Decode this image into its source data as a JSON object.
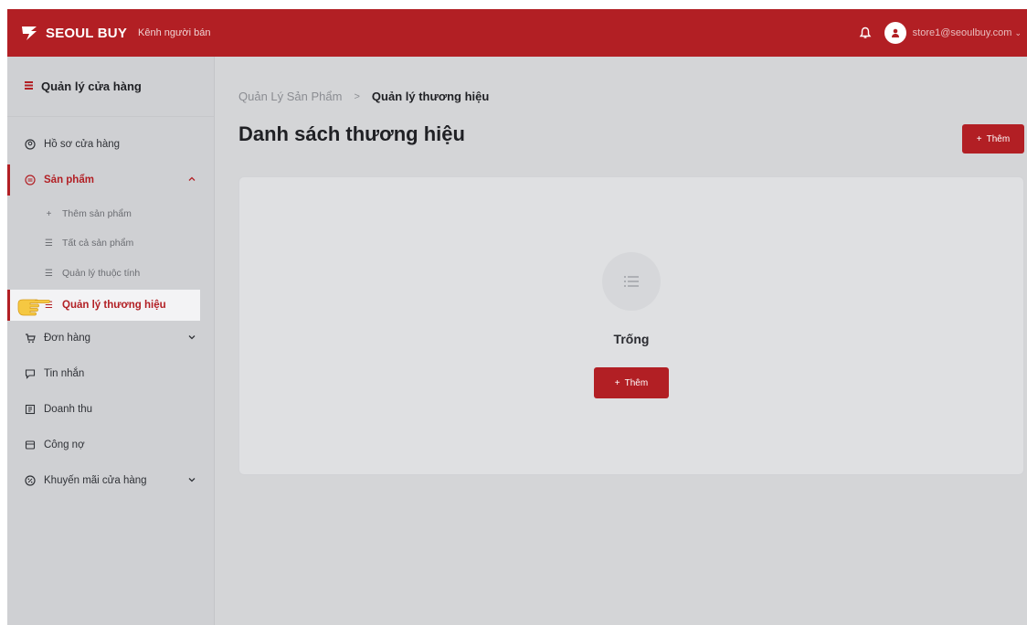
{
  "topbar": {
    "brand": "SEOUL BUY",
    "subtitle": "Kênh người bán",
    "user_email": "store1@seoulbuy.com",
    "caret": "⌄"
  },
  "sidebar": {
    "header": "Quản lý cửa hàng",
    "items": {
      "store_profile": "Hồ sơ cửa hàng",
      "products": "Sản phẩm",
      "add_product": "Thêm sản phẩm",
      "all_products": "Tất cả sản phẩm",
      "attributes": "Quản lý thuộc tính",
      "brands": "Quản lý thương hiệu",
      "orders": "Đơn hàng",
      "messages": "Tin nhắn",
      "revenue": "Doanh thu",
      "debt": "Công nợ",
      "promotions": "Khuyến mãi cửa hàng"
    },
    "sub_icons": {
      "add": "+",
      "list": "☰"
    }
  },
  "main": {
    "breadcrumb": {
      "parent": "Quản Lý Sản Phẩm",
      "separator": ">",
      "current": "Quản lý thương hiệu"
    },
    "title": "Danh sách thương hiệu",
    "add_button": {
      "plus": "+",
      "label": "Thêm"
    },
    "empty": {
      "text": "Trống",
      "button_plus": "+",
      "button_label": "Thêm"
    }
  },
  "colors": {
    "brand": "#b21f24",
    "overlay_gray": "#d4d5d7",
    "highlight": "#f3f3f5"
  }
}
